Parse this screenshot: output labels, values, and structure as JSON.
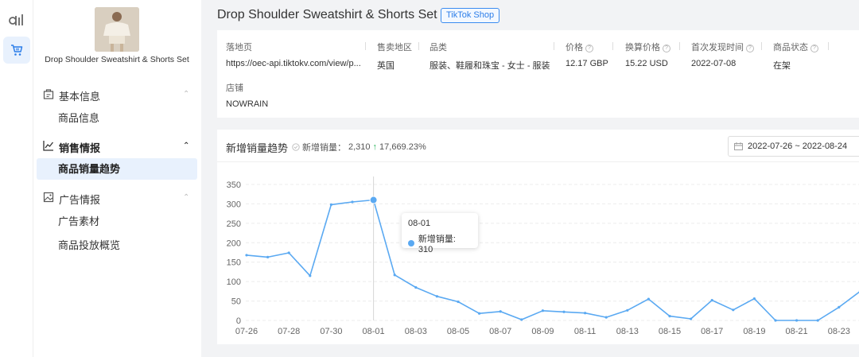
{
  "product": {
    "name": "Drop Shoulder Sweatshirt & Shorts Set",
    "platform_badge": "TikTok Shop"
  },
  "sidebar": {
    "groups": [
      {
        "label": "基本信息",
        "items": [
          "商品信息"
        ]
      },
      {
        "label": "销售情报",
        "items": [
          "商品销量趋势"
        ]
      },
      {
        "label": "广告情报",
        "items": [
          "广告素材",
          "商品投放概览"
        ]
      }
    ]
  },
  "info": {
    "landing_page": {
      "label": "落地页",
      "value": "https://oec-api.tiktokv.com/view/p..."
    },
    "region": {
      "label": "售卖地区",
      "value": "英国"
    },
    "category": {
      "label": "品类",
      "value": "服装、鞋履和珠宝 - 女士 - 服装"
    },
    "price": {
      "label": "价格",
      "value": "12.17 GBP"
    },
    "converted_price": {
      "label": "换算价格",
      "value": "15.22 USD"
    },
    "first_seen": {
      "label": "首次发现时间",
      "value": "2022-07-08"
    },
    "status": {
      "label": "商品状态",
      "value": "在架"
    },
    "store": {
      "label": "店铺",
      "value": "NOWRAIN"
    }
  },
  "trend": {
    "title": "新增销量趋势",
    "stat_label": "新增销量：",
    "stat_value": "2,310",
    "stat_change": "17,669.23%",
    "date_range": "2022-07-26 ~ 2022-08-24",
    "tooltip_date": "08-01",
    "tooltip_label": "新增销量: 310"
  },
  "colors": {
    "accent": "#2b7de9",
    "line": "#5aa9f2",
    "up": "#2ab45c"
  },
  "chart_data": {
    "type": "line",
    "ylim": [
      0,
      350
    ],
    "yticks": [
      0,
      50,
      100,
      150,
      200,
      250,
      300,
      350
    ],
    "x_tick_labels": [
      "07-26",
      "07-28",
      "07-30",
      "08-01",
      "08-03",
      "08-05",
      "08-07",
      "08-09",
      "08-11",
      "08-13",
      "08-15",
      "08-17",
      "08-19",
      "08-21",
      "08-23"
    ],
    "x": [
      "07-26",
      "07-27",
      "07-28",
      "07-29",
      "07-30",
      "07-31",
      "08-01",
      "08-02",
      "08-03",
      "08-04",
      "08-05",
      "08-06",
      "08-07",
      "08-08",
      "08-09",
      "08-10",
      "08-11",
      "08-12",
      "08-13",
      "08-14",
      "08-15",
      "08-16",
      "08-17",
      "08-18",
      "08-19",
      "08-20",
      "08-21",
      "08-22",
      "08-23",
      "08-24"
    ],
    "series": [
      {
        "name": "新增销量",
        "values": [
          168,
          163,
          174,
          115,
          298,
          305,
          310,
          117,
          85,
          62,
          48,
          18,
          23,
          2,
          25,
          22,
          19,
          8,
          26,
          55,
          11,
          4,
          52,
          27,
          56,
          0,
          0,
          0,
          34,
          75
        ]
      }
    ],
    "highlight_index": 6
  }
}
